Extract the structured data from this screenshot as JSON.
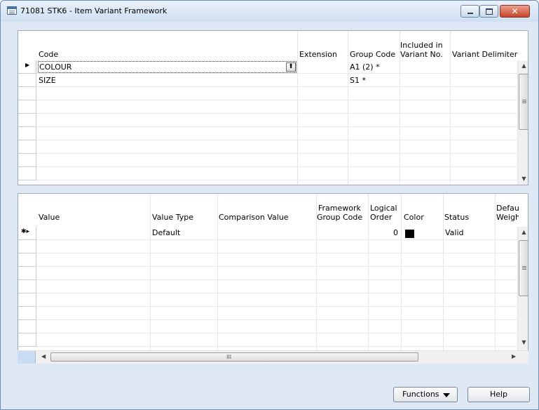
{
  "window": {
    "title": "71081 STK6 - Item Variant Framework",
    "close_glyph": "✕"
  },
  "grid1": {
    "headers": {
      "code": "Code",
      "extension": "Extension",
      "group_code": "Group Code",
      "included_line1": "Included in",
      "included_line2": "Variant No.",
      "variant_delimiter": "Variant Delimiter"
    },
    "rows": [
      {
        "selected": true,
        "code": "COLOUR",
        "extension": "",
        "group_code": "A1 (2) *"
      },
      {
        "selected": false,
        "code": "SIZE",
        "extension": "",
        "group_code": "S1 *"
      }
    ],
    "row_indicator": "▶",
    "dropdown_glyph": "⬆"
  },
  "grid2": {
    "headers": {
      "value": "Value",
      "value_type": "Value Type",
      "comparison_value": "Comparison Value",
      "framework_line1": "Framework",
      "framework_line2": "Group Code",
      "logical_line1": "Logical",
      "logical_line2": "Order",
      "color": "Color",
      "status": "Status",
      "default_line1": "Defau",
      "default_line2": "Weigh"
    },
    "rows": [
      {
        "indicator": "✱▸",
        "value": "",
        "value_type": "Default",
        "comparison_value": "",
        "framework_group_code": "",
        "logical_order": "0",
        "color": "#000000",
        "status": "Valid"
      }
    ],
    "hscroll_grip": "III"
  },
  "buttons": {
    "functions": "Functions",
    "help": "Help"
  },
  "icons": {
    "window": "window-icon",
    "minimize": "minimize-icon",
    "maximize": "maximize-icon",
    "close": "close-icon"
  }
}
